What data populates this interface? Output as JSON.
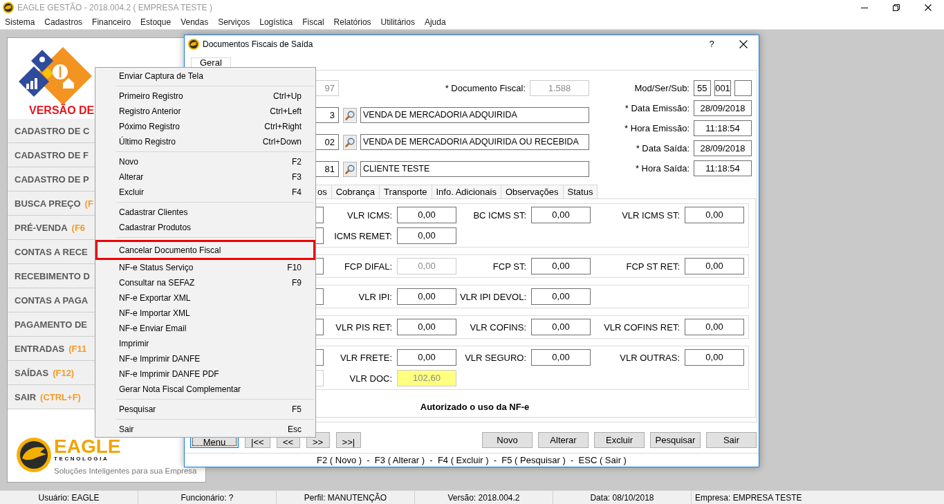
{
  "window": {
    "title": "EAGLE GESTÃO - 2018.004.2 ( EMPRESA TESTE )"
  },
  "menubar": [
    "Sistema",
    "Cadastros",
    "Financeiro",
    "Estoque",
    "Vendas",
    "Serviços",
    "Logística",
    "Fiscal",
    "Relatórios",
    "Utilitários",
    "Ajuda"
  ],
  "sidebar": {
    "version_label": "VERSÃO DE",
    "items": [
      {
        "label": "CADASTRO DE C"
      },
      {
        "label": "CADASTRO DE F"
      },
      {
        "label": "CADASTRO DE P"
      },
      {
        "label": "BUSCA PREÇO",
        "hotkey": "(F"
      },
      {
        "label": "PRÉ-VENDA",
        "hotkey": "(F6"
      },
      {
        "label": "CONTAS A RECE"
      },
      {
        "label": "RECEBIMENTO D"
      },
      {
        "label": "CONTAS A PAGA"
      },
      {
        "label": "PAGAMENTO DE"
      },
      {
        "label": "ENTRADAS",
        "hotkey": "(F11"
      },
      {
        "label": "SAÍDAS",
        "hotkey": "(F12)"
      },
      {
        "label": "SAIR",
        "hotkey": "(CTRL+F)"
      }
    ],
    "brand": {
      "name": "EAGLE",
      "subtitle": "TECNOLOGIA",
      "slogan": "Soluções Inteligentes para sua Empresa"
    }
  },
  "dialog": {
    "title": "Documentos Fiscais de Saída",
    "help": "?",
    "tabs": [
      {
        "label": "Geral",
        "selected": true
      }
    ],
    "header": {
      "rows": [
        {
          "kind": "document",
          "code": {
            "value": "97",
            "disabled": true
          },
          "label": "* Documento Fiscal:",
          "field": {
            "value": "1.588",
            "disabled": true
          }
        },
        {
          "kind": "lookup",
          "code": {
            "value": "3",
            "disabled": false
          },
          "description": {
            "value": "VENDA DE MERCADORIA ADQUIRIDA",
            "disabled": false
          }
        },
        {
          "kind": "lookup",
          "code": {
            "value": "02",
            "disabled": false
          },
          "description": {
            "value": "VENDA DE MERCADORIA ADQUIRIDA OU RECEBIDA",
            "disabled": false
          }
        },
        {
          "kind": "lookup",
          "code": {
            "value": "81",
            "disabled": false
          },
          "description": {
            "value": "CLIENTE TESTE",
            "disabled": false
          }
        }
      ],
      "right_fields": [
        {
          "label": "Mod/Ser/Sub:",
          "fields": [
            {
              "value": "55",
              "disabled": false
            },
            {
              "value": "001",
              "disabled": false
            },
            {
              "disabled": false
            }
          ]
        },
        {
          "label": "* Data Emissão:",
          "fields": [
            {
              "value": "28/09/2018",
              "disabled": false
            }
          ]
        },
        {
          "label": "* Hora Emissão:",
          "fields": [
            {
              "value": "11:18:54",
              "disabled": false
            }
          ]
        },
        {
          "label": "* Data Saída:",
          "fields": [
            {
              "value": "28/09/2018",
              "disabled": false
            }
          ]
        },
        {
          "label": "* Hora Saída:",
          "fields": [
            {
              "value": "11:18:54",
              "disabled": false
            }
          ]
        }
      ]
    },
    "inner_tabs": [
      {
        "label": "os",
        "selected": false
      },
      {
        "label": "Cobrança",
        "selected": false
      },
      {
        "label": "Transporte",
        "selected": false
      },
      {
        "label": "Info. Adicionais",
        "selected": false
      },
      {
        "label": "Observações",
        "selected": false
      },
      {
        "label": "Status",
        "selected": false
      }
    ],
    "groups": [
      {
        "rows": [
          {
            "lead": {
              "disabled": false
            },
            "cells": [
              {
                "label": "VLR ICMS:",
                "value": "0,00",
                "disabled": false,
                "highlighted": false
              },
              {
                "label": "BC ICMS ST:",
                "value": "0,00",
                "disabled": false,
                "highlighted": false
              },
              {
                "label": "VLR ICMS ST:",
                "value": "0,00",
                "disabled": false,
                "highlighted": false
              }
            ]
          },
          {
            "lead": {
              "disabled": false
            },
            "cells": [
              {
                "label": "ICMS REMET:",
                "value": "0,00",
                "disabled": false,
                "highlighted": false
              }
            ]
          }
        ]
      },
      {
        "rows": [
          {
            "lead": {
              "disabled": false
            },
            "cells": [
              {
                "label": "FCP DIFAL:",
                "value": "0,00",
                "disabled": true,
                "highlighted": false
              },
              {
                "label": "FCP ST:",
                "value": "0,00",
                "disabled": false,
                "highlighted": false
              },
              {
                "label": "FCP ST RET:",
                "value": "0,00",
                "disabled": false,
                "highlighted": false
              }
            ]
          }
        ]
      },
      {
        "rows": [
          {
            "lead": {
              "disabled": false
            },
            "cells": [
              {
                "label": "VLR IPI:",
                "value": "0,00",
                "disabled": false,
                "highlighted": false
              },
              {
                "label": "VLR IPI DEVOL:",
                "value": "0,00",
                "disabled": false,
                "highlighted": false
              }
            ]
          }
        ]
      },
      {
        "rows": [
          {
            "lead": {
              "disabled": false
            },
            "cells": [
              {
                "label": "VLR PIS RET:",
                "value": "0,00",
                "disabled": false,
                "highlighted": false
              },
              {
                "label": "VLR COFINS:",
                "value": "0,00",
                "disabled": false,
                "highlighted": false
              },
              {
                "label": "VLR COFINS RET:",
                "value": "0,00",
                "disabled": false,
                "highlighted": false
              }
            ]
          }
        ]
      },
      {
        "rows": [
          {
            "lead": {
              "disabled": false
            },
            "cells": [
              {
                "label": "VLR FRETE:",
                "value": "0,00",
                "disabled": false,
                "highlighted": false
              },
              {
                "label": "VLR SEGURO:",
                "value": "0,00",
                "disabled": false,
                "highlighted": false
              },
              {
                "label": "VLR OUTRAS:",
                "value": "0,00",
                "disabled": false,
                "highlighted": false
              }
            ]
          },
          {
            "lead": {
              "disabled": true
            },
            "cells": [
              {
                "label": "VLR DOC:",
                "value": "102,60",
                "disabled": true,
                "highlighted": true
              }
            ]
          }
        ]
      }
    ],
    "status_message": "Autorizado o uso da NF-e",
    "nav_buttons": [
      {
        "label": "Menu",
        "focused": true
      },
      {
        "label": "|<<",
        "focused": false
      },
      {
        "label": "<<",
        "focused": false
      },
      {
        "label": ">>",
        "focused": false
      },
      {
        "label": ">>|",
        "focused": false
      }
    ],
    "action_buttons": [
      "Novo",
      "Alterar",
      "Excluir",
      "Pesquisar",
      "Sair"
    ],
    "shortcuts_hint": "F2 ( Novo )  -  F3 ( Alterar )  -  F4 ( Excluir )  -  F5 ( Pesquisar )  -  ESC ( Sair )"
  },
  "context_menu": [
    {
      "kind": "item",
      "label": "Enviar Captura de Tela",
      "highlighted": false
    },
    {
      "kind": "separator"
    },
    {
      "kind": "item",
      "label": "Primeiro Registro",
      "shortcut": "Ctrl+Up",
      "highlighted": false
    },
    {
      "kind": "item",
      "label": "Registro Anterior",
      "shortcut": "Ctrl+Left",
      "highlighted": false
    },
    {
      "kind": "item",
      "label": "Póximo Registro",
      "shortcut": "Ctrl+Right",
      "highlighted": false
    },
    {
      "kind": "item",
      "label": "Último Registro",
      "shortcut": "Ctrl+Down",
      "highlighted": false
    },
    {
      "kind": "separator"
    },
    {
      "kind": "item",
      "label": "Novo",
      "shortcut": "F2",
      "highlighted": false
    },
    {
      "kind": "item",
      "label": "Alterar",
      "shortcut": "F3",
      "highlighted": false
    },
    {
      "kind": "item",
      "label": "Excluir",
      "shortcut": "F4",
      "highlighted": false
    },
    {
      "kind": "separator"
    },
    {
      "kind": "item",
      "label": "Cadastrar Clientes",
      "highlighted": false
    },
    {
      "kind": "item",
      "label": "Cadastrar Produtos",
      "highlighted": false
    },
    {
      "kind": "separator"
    },
    {
      "kind": "item",
      "label": "Cancelar Documento Fiscal",
      "highlighted": true
    },
    {
      "kind": "item",
      "label": "NF-e Status Serviço",
      "shortcut": "F10",
      "highlighted": false
    },
    {
      "kind": "item",
      "label": "Consultar na SEFAZ",
      "shortcut": "F9",
      "highlighted": false
    },
    {
      "kind": "item",
      "label": "NF-e Exportar XML",
      "highlighted": false
    },
    {
      "kind": "item",
      "label": "NF-e Importar XML",
      "highlighted": false
    },
    {
      "kind": "item",
      "label": "NF-e Enviar Email",
      "highlighted": false
    },
    {
      "kind": "item",
      "label": "Imprimir",
      "highlighted": false
    },
    {
      "kind": "item",
      "label": "NF-e Imprimir DANFE",
      "highlighted": false
    },
    {
      "kind": "item",
      "label": "NF-e Imprimir DANFE PDF",
      "highlighted": false
    },
    {
      "kind": "item",
      "label": "Gerar Nota Fiscal Complementar",
      "highlighted": false
    },
    {
      "kind": "separator"
    },
    {
      "kind": "item",
      "label": "Pesquisar",
      "shortcut": "F5",
      "highlighted": false
    },
    {
      "kind": "separator"
    },
    {
      "kind": "item",
      "label": "Sair",
      "shortcut": "Esc",
      "highlighted": false
    }
  ],
  "status_bar": [
    "Usuário: EAGLE",
    "Funcionário: ?",
    "Perfil: MANUTENÇÃO",
    "Versão: 2018.004.2",
    "Data: 08/10/2018",
    "Empresa: EMPRESA TESTE"
  ]
}
